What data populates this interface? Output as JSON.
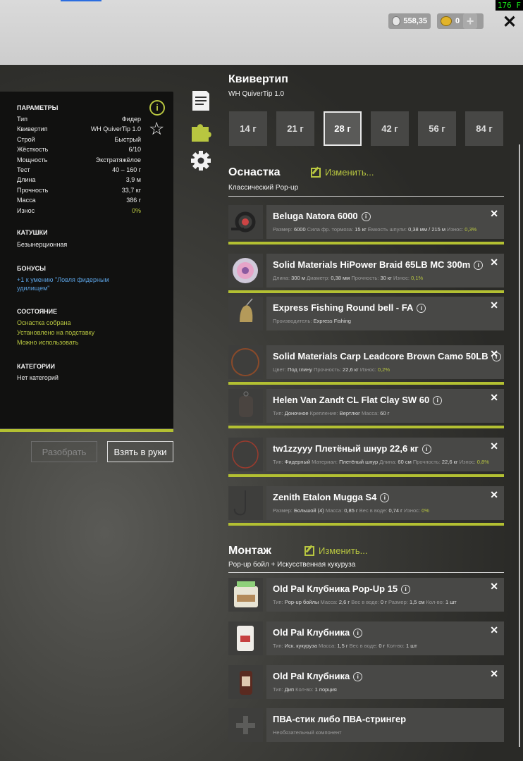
{
  "fps": "176 F",
  "currency": {
    "silver": "558,35",
    "gold": "0",
    "plus": "+"
  },
  "close_label": "✕",
  "params": {
    "title": "ПАРАМЕТРЫ",
    "rows": [
      {
        "k": "Тип",
        "v": "Фидер"
      },
      {
        "k": "Квивертип",
        "v": "WH QuiverTip 1.0"
      },
      {
        "k": "Строй",
        "v": "Быстрый"
      },
      {
        "k": "Жёсткость",
        "v": "6/10"
      },
      {
        "k": "Мощность",
        "v": "Экстратяжёлое"
      },
      {
        "k": "Тест",
        "v": "40 – 160 г"
      },
      {
        "k": "Длина",
        "v": "3,9 м"
      },
      {
        "k": "Прочность",
        "v": "33,7 кг"
      },
      {
        "k": "Масса",
        "v": "386 г"
      },
      {
        "k": "Износ",
        "v": "0%"
      }
    ]
  },
  "reels": {
    "title": "КАТУШКИ",
    "value": "Безынерционная"
  },
  "bonuses": {
    "title": "БОНУСЫ",
    "line1": "+1 к умению \"Ловля фидерным",
    "line2": "удилищем\""
  },
  "state": {
    "title": "СОСТОЯНИЕ",
    "l1": "Оснастка собрана",
    "l2": "Установлено на подставку",
    "l3": "Можно использовать"
  },
  "categories": {
    "title": "КАТЕГОРИИ",
    "value": "Нет категорий"
  },
  "buttons": {
    "disassemble": "Разобрать",
    "take": "Взять в руки"
  },
  "quiver": {
    "title": "Квивертип",
    "subtitle": "WH QuiverTip 1.0",
    "weights": [
      "14 г",
      "21 г",
      "28 г",
      "42 г",
      "56 г",
      "84 г"
    ],
    "selected_index": 2
  },
  "rig": {
    "title": "Оснастка",
    "subtitle": "Классический Pop-up",
    "edit": "Изменить..."
  },
  "items": [
    {
      "name": "Beluga Natora 6000",
      "props": [
        [
          "Размер:",
          "6000"
        ],
        [
          "Сила фр. тормоза:",
          "15 кг"
        ],
        [
          "Ёмкость шпули:",
          "0,38 мм / 215 м"
        ],
        [
          "Износ:",
          "0,3%"
        ]
      ]
    },
    {
      "name": "Solid Materials HiPower Braid 65LB MC 300m",
      "props": [
        [
          "Длина:",
          "300 м"
        ],
        [
          "Диаметр:",
          "0,38 мм"
        ],
        [
          "Прочность:",
          "30 кг"
        ],
        [
          "Износ:",
          "0,1%"
        ]
      ]
    },
    {
      "name": "Express Fishing Round bell - FA",
      "props": [
        [
          "Производитель:",
          "Express Fishing"
        ]
      ]
    },
    {
      "name": "Solid Materials Carp Leadcore Brown Camo 50LB",
      "props": [
        [
          "Цвет:",
          "Под глину"
        ],
        [
          "Прочность:",
          "22,6 кг"
        ],
        [
          "Износ:",
          "0,2%"
        ]
      ]
    },
    {
      "name": "Helen Van Zandt CL Flat Clay SW 60",
      "props": [
        [
          "Тип:",
          "Доночное"
        ],
        [
          "Крепление:",
          "Вертлюг"
        ],
        [
          "Масса:",
          "60 г"
        ]
      ]
    },
    {
      "name": "tw1zzyyy Плетёный шнур 22,6 кг",
      "props": [
        [
          "Тип:",
          "Фидерный"
        ],
        [
          "Материал:",
          "Плетёный шнур"
        ],
        [
          "Длина:",
          "60 см"
        ],
        [
          "Прочность:",
          "22,6 кг"
        ],
        [
          "Износ:",
          "0,8%"
        ]
      ]
    },
    {
      "name": "Zenith Etalon Mugga S4",
      "props": [
        [
          "Размер:",
          "Большой (4)"
        ],
        [
          "Масса:",
          "0,85 г"
        ],
        [
          "Вес в воде:",
          "0,74 г"
        ],
        [
          "Износ:",
          "0%"
        ]
      ]
    }
  ],
  "mount": {
    "title": "Монтаж",
    "subtitle": "Pop-up бойл + Искусственная кукуруза",
    "edit": "Изменить..."
  },
  "baits": [
    {
      "name": "Old Pal Клубника Pop-Up 15",
      "props": [
        [
          "Тип:",
          "Pop-up бойлы"
        ],
        [
          "Масса:",
          "2,6 г"
        ],
        [
          "Вес в воде:",
          "0 г"
        ],
        [
          "Размер:",
          "1,5 см"
        ],
        [
          "Кол-во:",
          "1 шт"
        ]
      ]
    },
    {
      "name": "Old Pal Клубника",
      "props": [
        [
          "Тип:",
          "Иск. кукуруза"
        ],
        [
          "Масса:",
          "1,5 г"
        ],
        [
          "Вес в воде:",
          "0 г"
        ],
        [
          "Кол-во:",
          "1 шт"
        ]
      ]
    },
    {
      "name": "Old Pal Клубника",
      "props": [
        [
          "Тип:",
          "Дип"
        ],
        [
          "Кол-во:",
          "1 порция"
        ]
      ]
    }
  ],
  "pva": {
    "name": "ПВА-стик либо ПВА-стрингер",
    "hint": "Необязательный компонент"
  }
}
